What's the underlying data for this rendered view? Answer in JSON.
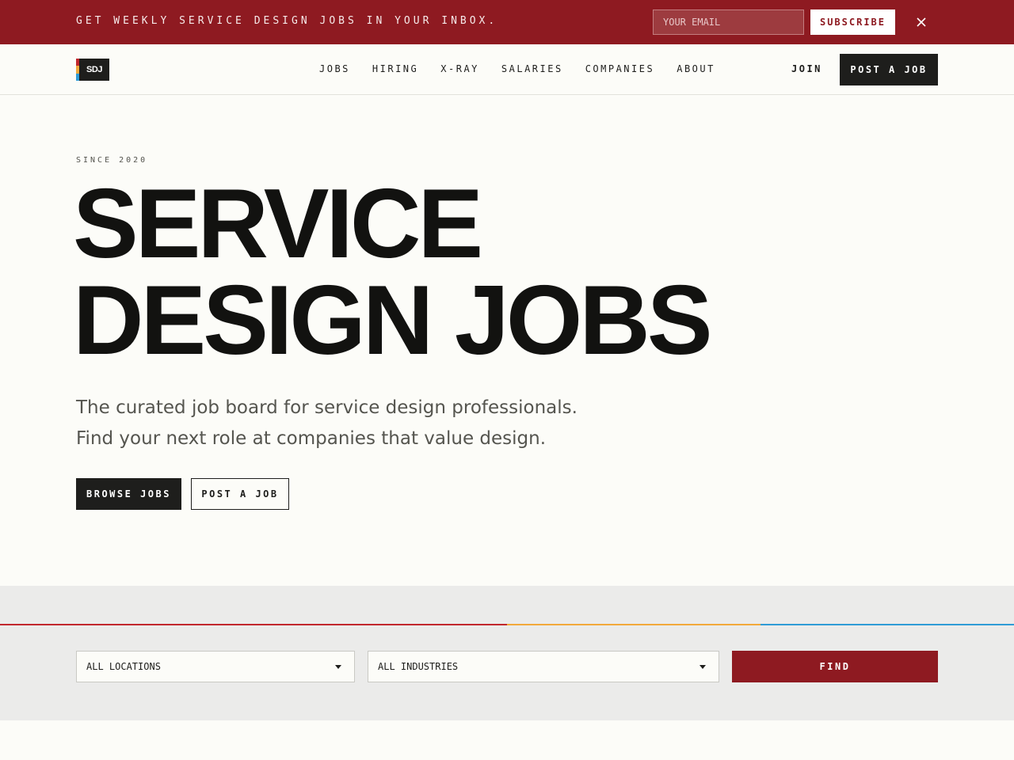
{
  "banner": {
    "text": "Get weekly service design jobs in your inbox.",
    "email_placeholder": "YOUR EMAIL",
    "subscribe_label": "SUBSCRIBE",
    "close_icon": "close-icon",
    "background_color": "#8e1a21"
  },
  "header": {
    "logo_text": "SDJ",
    "logo_stripe_colors": [
      "#c1272d",
      "#f2a93b",
      "#2f9bd6"
    ],
    "nav": [
      {
        "label": "JOBS"
      },
      {
        "label": "HIRING"
      },
      {
        "label": "X-RAY"
      },
      {
        "label": "SALARIES"
      },
      {
        "label": "COMPANIES"
      },
      {
        "label": "ABOUT"
      }
    ],
    "join_label": "JOIN",
    "post_job_label": "POST A JOB"
  },
  "hero": {
    "eyebrow": "SINCE 2020",
    "title_line1": "SERVICE",
    "title_line2": "DESIGN JOBS",
    "subtitle_line1": "The curated job board for service design professionals.",
    "subtitle_line2": "Find your next role at companies that value design.",
    "browse_label": "BROWSE JOBS",
    "post_label": "POST A JOB"
  },
  "filters": {
    "rule_colors": [
      "#c1272d",
      "#f2a93b",
      "#2f9bd6"
    ],
    "location_value": "ALL LOCATIONS",
    "industry_value": "ALL INDUSTRIES",
    "find_label": "FIND",
    "accent_color": "#8e1a21"
  }
}
